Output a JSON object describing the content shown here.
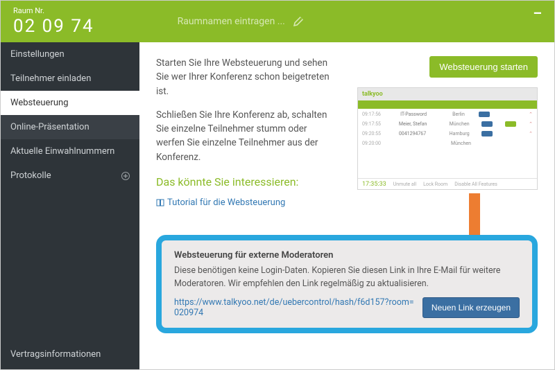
{
  "header": {
    "room_label": "Raum Nr.",
    "room_number": "02 09 74",
    "roomname_placeholder": "Raumnamen eintragen ..."
  },
  "sidebar": {
    "items": [
      {
        "label": "Einstellungen"
      },
      {
        "label": "Teilnehmer einladen"
      },
      {
        "label": "Websteuerung"
      },
      {
        "label": "Online-Präsentation"
      },
      {
        "label": "Aktuelle Einwahlnummern"
      },
      {
        "label": "Protokolle"
      }
    ],
    "bottom": "Vertragsinformationen"
  },
  "main": {
    "p1": "Starten Sie Ihre Websteuerung und sehen Sie wer Ihrer Konferenz schon beigetreten ist.",
    "p2": "Schließen Sie Ihre Konferenz ab, schalten Sie einzelne Teilnehmer stumm oder werfen Sie einzelne Teilnehmer aus der Konferenz.",
    "interest_heading": "Das könnte Sie interessieren:",
    "tutorial_label": "Tutorial für die Websteuerung",
    "start_button": "Websteuerung starten"
  },
  "preview": {
    "logo": "talkyoo",
    "rows": [
      {
        "time": "09:17:56",
        "name": "IT-Password",
        "city": "Berlin"
      },
      {
        "time": "09:17:55",
        "name": "Meier, Stefan",
        "city": "München"
      },
      {
        "time": "09:20:55",
        "name": "0041294767",
        "city": "Hamburg"
      },
      {
        "time": "09:20:00",
        "name": "",
        "city": "München"
      }
    ],
    "timer": "17:35:33",
    "foot1": "Unmute all",
    "foot2": "Lock Room",
    "foot3": "Disable All Features"
  },
  "extbox": {
    "title": "Websteuerung für externe Moderatoren",
    "desc": "Diese benötigen keine Login-Daten. Kopieren Sie diesen Link in Ihre E-Mail für weitere Moderatoren. Wir empfehlen den Link regelmäßig zu aktualisieren.",
    "url": "https://www.talkyoo.net/de/uebercontrol/hash/f6d157?room=020974",
    "button": "Neuen Link erzeugen"
  }
}
